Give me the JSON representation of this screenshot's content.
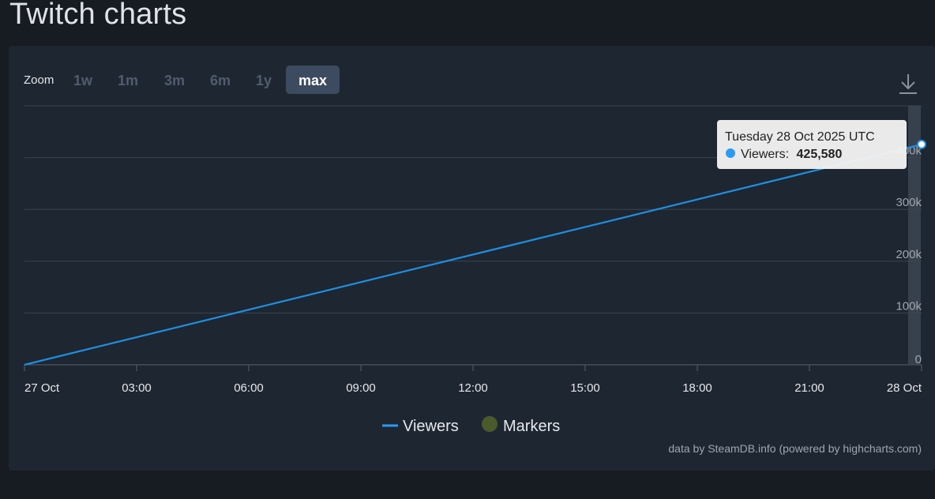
{
  "page": {
    "title": "Twitch charts"
  },
  "zoom": {
    "label": "Zoom",
    "buttons": [
      "1w",
      "1m",
      "3m",
      "6m",
      "1y",
      "max"
    ],
    "active": "max"
  },
  "export_icon": "download-icon",
  "tooltip": {
    "date": "Tuesday 28 Oct 2025 UTC",
    "series_label": "Viewers:",
    "value": "425,580",
    "bullet_color": "#2b9af3"
  },
  "legend": {
    "viewers": "Viewers",
    "markers": "Markers",
    "viewers_color": "#2b9af3",
    "markers_color": "#4a5a2a"
  },
  "credits": "data by SteamDB.info (powered by highcharts.com)",
  "colors": {
    "line": "#1f8fe0",
    "background": "#1e2631",
    "page_background": "#171b22"
  },
  "chart_data": {
    "type": "line",
    "x_tick_labels": [
      "27 Oct",
      "03:00",
      "06:00",
      "09:00",
      "12:00",
      "15:00",
      "18:00",
      "21:00",
      "28 Oct"
    ],
    "x_range": [
      "27 Oct 00:00",
      "28 Oct 00:00"
    ],
    "y_tick_labels": [
      "0",
      "100k",
      "200k",
      "300k",
      "400k"
    ],
    "y_ticks": [
      0,
      100000,
      200000,
      300000,
      400000
    ],
    "ylim": [
      0,
      500000
    ],
    "grid": true,
    "legend_position": "bottom-center",
    "series": [
      {
        "name": "Viewers",
        "x": [
          "27 Oct 00:00",
          "28 Oct 00:00"
        ],
        "values": [
          0,
          425580
        ]
      }
    ],
    "highlighted_point": {
      "x": "28 Oct 00:00",
      "value": 425580
    }
  }
}
